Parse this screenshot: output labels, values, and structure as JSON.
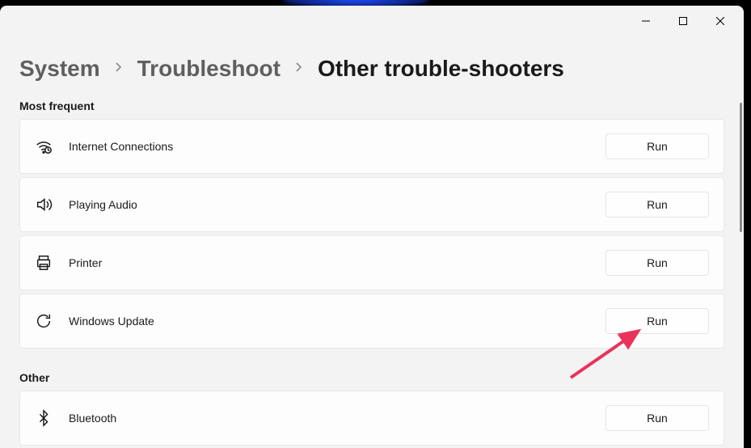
{
  "breadcrumb": {
    "system": "System",
    "troubleshoot": "Troubleshoot",
    "current": "Other trouble-shooters"
  },
  "sections": {
    "most_frequent": {
      "title": "Most frequent",
      "items": [
        {
          "icon": "wifi-icon",
          "label": "Internet Connections",
          "button": "Run"
        },
        {
          "icon": "audio-icon",
          "label": "Playing Audio",
          "button": "Run"
        },
        {
          "icon": "printer-icon",
          "label": "Printer",
          "button": "Run"
        },
        {
          "icon": "update-icon",
          "label": "Windows Update",
          "button": "Run"
        }
      ]
    },
    "other": {
      "title": "Other",
      "items": [
        {
          "icon": "bluetooth-icon",
          "label": "Bluetooth",
          "button": "Run"
        }
      ]
    }
  },
  "annotation": {
    "arrow_target": "windows-update-run-button",
    "color": "#e8345a"
  }
}
